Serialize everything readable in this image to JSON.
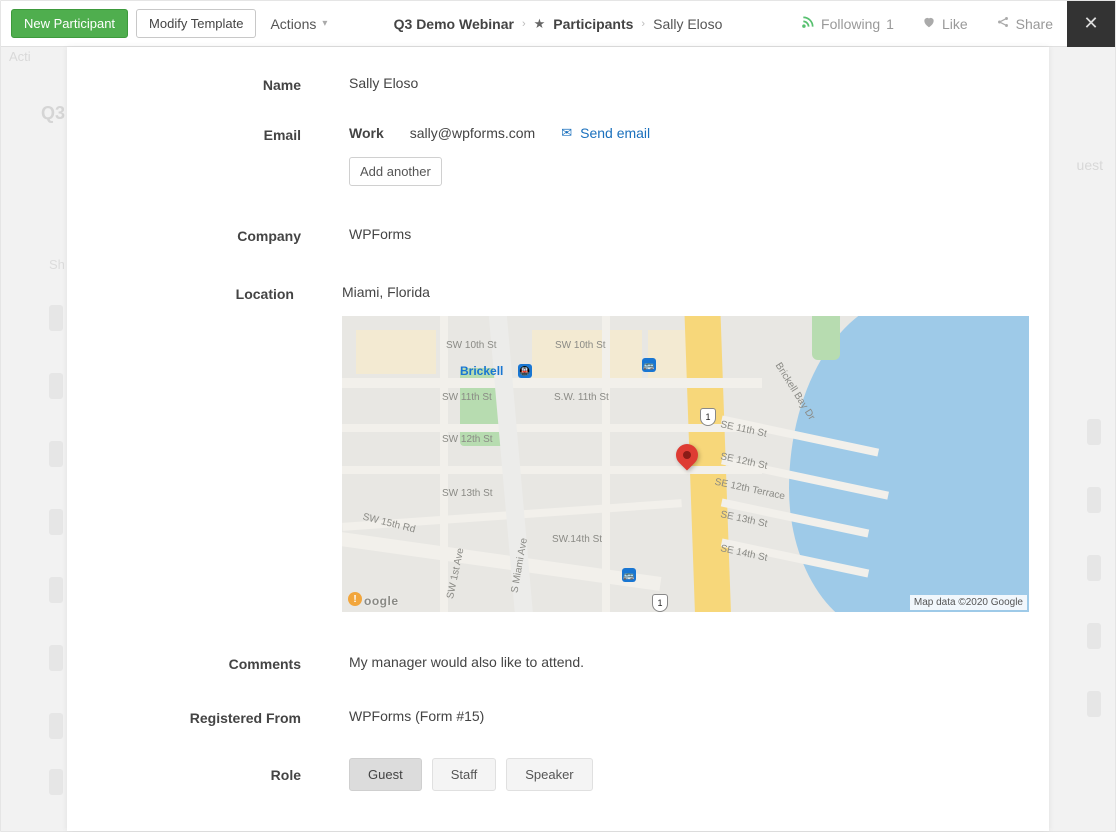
{
  "header": {
    "new_participant": "New Participant",
    "modify_template": "Modify Template",
    "actions": "Actions",
    "breadcrumb": {
      "root": "Q3 Demo Webinar",
      "participants": "Participants",
      "current": "Sally Eloso"
    },
    "following_label": "Following",
    "following_count": "1",
    "like": "Like",
    "share": "Share"
  },
  "backdrop": {
    "left_item": "Acti",
    "q3": "Q3",
    "sh": "Sh",
    "right_text": "uest"
  },
  "fields": {
    "name_label": "Name",
    "name": "Sally Eloso",
    "email_label": "Email",
    "email_type": "Work",
    "email": "sally@wpforms.com",
    "send_email": "Send email",
    "add_another": "Add another",
    "company_label": "Company",
    "company": "WPForms",
    "location_label": "Location",
    "location": "Miami, Florida",
    "comments_label": "Comments",
    "comments": "My manager would also like to attend.",
    "registered_label": "Registered From",
    "registered": "WPForms (Form #15)",
    "role_label": "Role",
    "role_options": {
      "guest": "Guest",
      "staff": "Staff",
      "speaker": "Speaker"
    }
  },
  "map": {
    "brickell": "Brickell",
    "us1": "1",
    "streets": {
      "sw10": "SW 10th St",
      "sw11": "SW 11th St",
      "sw11b": "S.W. 11th St",
      "sw12": "SW 12th St",
      "sw13": "SW 13th St",
      "sw14": "SW.14th St",
      "sw15rd": "SW 15th Rd",
      "se11": "SE 11th St",
      "se12": "SE 12th St",
      "se12ter": "SE 12th Terrace",
      "se13": "SE 13th St",
      "se14": "SE 14th St",
      "brickell_bay": "Brickell Bay Dr",
      "sw1ave": "SW 1st Ave",
      "smima": "S Miami Ave"
    },
    "logo": "oogle",
    "attribution": "Map data ©2020 Google"
  }
}
